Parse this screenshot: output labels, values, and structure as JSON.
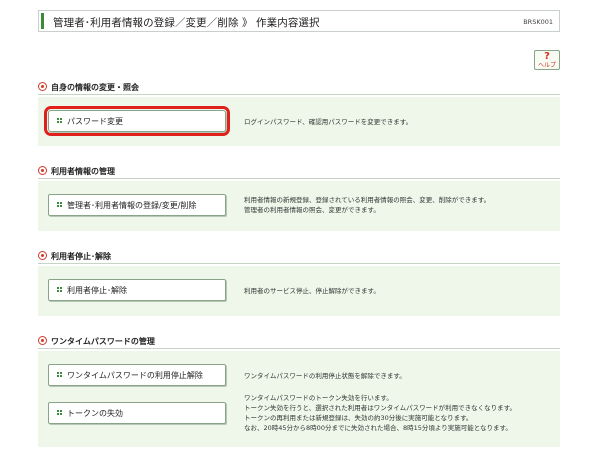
{
  "header": {
    "title": "管理者･利用者情報の登録／変更／削除 》 作業内容選択",
    "screen_id": "BRSK001"
  },
  "help": {
    "icon": "?",
    "label": "ヘルプ"
  },
  "sections": [
    {
      "title": "自身の情報の変更・照会",
      "items": [
        {
          "label": "パスワード変更",
          "desc": [
            "ログインパスワード、確認用パスワードを変更できます。"
          ]
        }
      ]
    },
    {
      "title": "利用者情報の管理",
      "items": [
        {
          "label": "管理者･利用者情報の登録/変更/削除",
          "desc": [
            "利用者情報の新規登録、登録されている利用者情報の照会、変更、削除ができます。",
            "管理者の利用者情報の照会、変更ができます。"
          ]
        }
      ]
    },
    {
      "title": "利用者停止･解除",
      "items": [
        {
          "label": "利用者停止･解除",
          "desc": [
            "利用者のサービス停止、停止解除ができます。"
          ]
        }
      ]
    },
    {
      "title": "ワンタイムパスワードの管理",
      "items": [
        {
          "label": "ワンタイムパスワードの利用停止解除",
          "desc": [
            "ワンタイムパスワードの利用停止状態を解除できます。"
          ]
        },
        {
          "label": "トークンの失効",
          "desc": [
            "ワンタイムパスワードのトークン失効を行います。",
            "トークン失効を行うと、選択された利用者はワンタイムパスワードが利用できなくなります。",
            "トークンの再利用または新規登録は、失効の約30分後に実施可能となります。",
            "なお、20時45分から8時00分までに失効された場合、8時15分頃より実施可能となります。"
          ]
        }
      ]
    }
  ],
  "colors": {
    "accent_green": "#3a8a3a",
    "panel_bg": "#eef7ea",
    "selection_red": "#e0201a",
    "bullet_red": "#d03a2a"
  }
}
